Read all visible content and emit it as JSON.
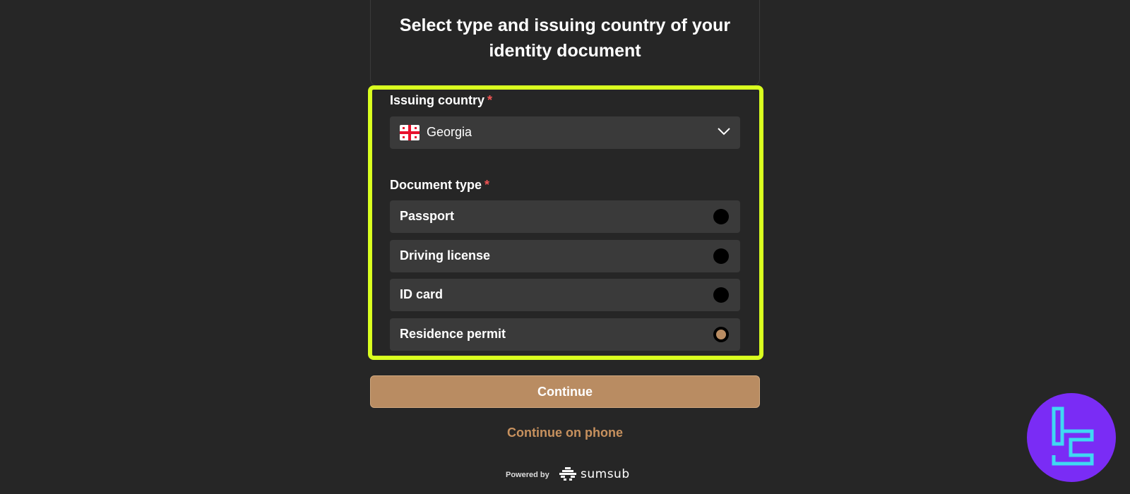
{
  "title": "Select type and issuing country of your identity document",
  "issuing_country": {
    "label": "Issuing country",
    "required_mark": "*",
    "value": "Georgia",
    "flag_icon": "georgia-flag-icon"
  },
  "document_type": {
    "label": "Document type",
    "required_mark": "*",
    "options": [
      {
        "label": "Passport",
        "selected": false
      },
      {
        "label": "Driving license",
        "selected": false
      },
      {
        "label": "ID card",
        "selected": false
      },
      {
        "label": "Residence permit",
        "selected": true
      }
    ]
  },
  "actions": {
    "continue_label": "Continue",
    "phone_label": "Continue on phone"
  },
  "footer": {
    "powered_by": "Powered by",
    "brand": "sumsub"
  },
  "colors": {
    "background": "#262626",
    "accent": "#b98c62",
    "highlight": "#d9ff1f",
    "required": "#f05454",
    "badge": "#7a2cf5"
  }
}
